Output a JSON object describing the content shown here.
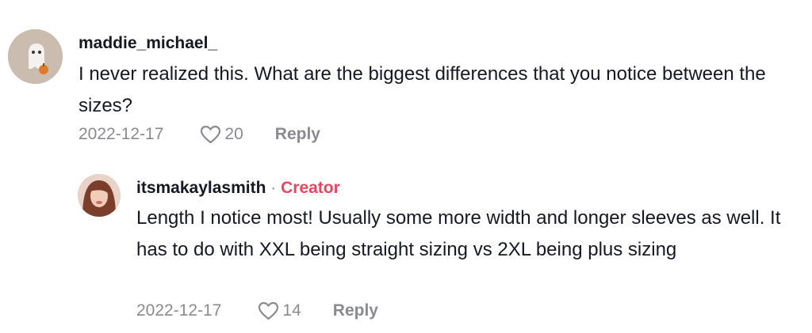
{
  "comments": [
    {
      "username": "maddie_michael_",
      "text": "I never realized this. What are the biggest differences that you notice between the sizes?",
      "date": "2022-12-17",
      "likes": "20",
      "reply_label": "Reply"
    },
    {
      "username": "itsmakaylasmith",
      "separator": "·",
      "badge": "Creator",
      "text": "Length I notice most! Usually some more width and longer sleeves as well. It has to do with XXL being straight sizing vs 2XL being plus sizing",
      "date": "2022-12-17",
      "likes": "14",
      "reply_label": "Reply"
    }
  ],
  "colors": {
    "creator_badge": "#e8455f",
    "meta_text": "#8a8b91",
    "primary_text": "#161823"
  }
}
